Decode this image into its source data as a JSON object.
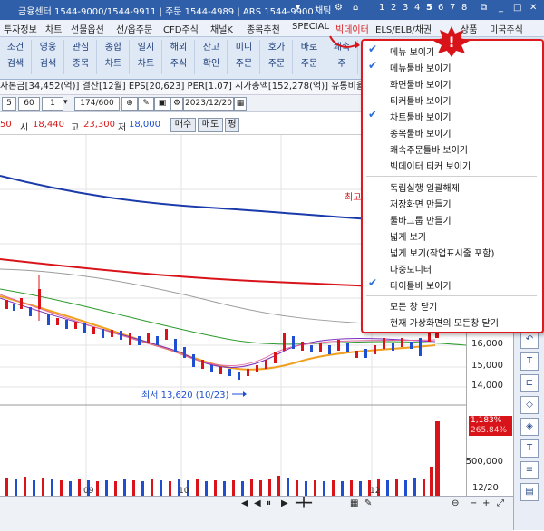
{
  "titlebar": {
    "center": "금융센터 1544-9000/1544-9911 | 주문 1544-4989 | ARS 1544-9900",
    "chat": "채팅",
    "pages": [
      "1",
      "2",
      "3",
      "4",
      "5",
      "6",
      "7",
      "8"
    ]
  },
  "menubar": {
    "items": [
      "투자정보",
      "차트",
      "선물옵션",
      "선/옵주문",
      "CFD주식",
      "채널K",
      "종목추천",
      "SPECIAL",
      "빅데이터",
      "ELS/ELB/채권",
      "상품",
      "미국주식"
    ]
  },
  "toolbar": {
    "buttons": [
      {
        "l1": "조건",
        "l2": "검색"
      },
      {
        "l1": "영웅",
        "l2": "검색"
      },
      {
        "l1": "관심",
        "l2": "종목"
      },
      {
        "l1": "종합",
        "l2": "차트"
      },
      {
        "l1": "일지",
        "l2": "차트"
      },
      {
        "l1": "해외",
        "l2": "주식"
      },
      {
        "l1": "잔고",
        "l2": "확인"
      },
      {
        "l1": "미니",
        "l2": "주문"
      },
      {
        "l1": "호가",
        "l2": "주문"
      },
      {
        "l1": "바로",
        "l2": "주문"
      },
      {
        "l1": "쾌속",
        "l2": "주"
      }
    ]
  },
  "infoline": "자본금[34,452(억)] 결산[12월] EPS[20,623] PER[1.07] 시가총액[152,278(억)] 유통비율",
  "controls": {
    "period": "5",
    "interval": "60",
    "step": "1",
    "count": "174/600",
    "date": "2023/12/20"
  },
  "pricerow": {
    "prefix": "50",
    "open_label": "시",
    "open": "18,440",
    "high_label": "고",
    "high": "23,300",
    "low_label": "저",
    "low": "18,000",
    "buy": "매수",
    "sell": "매도",
    "eval": "평"
  },
  "chart": {
    "ticks": [
      "16,000",
      "15,000",
      "14,000",
      "500,000"
    ],
    "low_label": "최저 13,620 (10/23)",
    "high_label_partial": "최고",
    "rate1": "1,183%",
    "rate2": "265.84%",
    "months": [
      "09",
      "10",
      "12"
    ],
    "date_label": "12/20"
  },
  "menu": {
    "items": [
      {
        "label": "메뉴 보이기",
        "checked": true
      },
      {
        "label": "메뉴툴바 보이기",
        "checked": true
      },
      {
        "label": "화면툴바 보이기",
        "checked": false
      },
      {
        "label": "티커툴바 보이기",
        "checked": false
      },
      {
        "label": "차트툴바 보이기",
        "checked": true
      },
      {
        "label": "종목툴바 보이기",
        "checked": false
      },
      {
        "label": "쾌속주문툴바 보이기",
        "checked": false
      },
      {
        "label": "빅데이터 티커 보이기",
        "checked": false
      },
      {
        "label": "독립실행 일괄해제",
        "checked": false
      },
      {
        "label": "저장화면 만들기",
        "checked": false
      },
      {
        "label": "툴바그룹 만들기",
        "checked": false
      },
      {
        "label": "넓게 보기",
        "checked": false
      },
      {
        "label": "넓게 보기(작업표시줄 포함)",
        "checked": false
      },
      {
        "label": "다중모니터",
        "checked": false
      },
      {
        "label": "타이틀바 보이기",
        "checked": true
      },
      {
        "label": "모든 창 닫기",
        "checked": false
      },
      {
        "label": "현재 가상화면의 모든창 닫기",
        "checked": false
      }
    ]
  },
  "colors": {
    "accent": "#2f5fa8",
    "menu_border": "#e0191f",
    "up": "#e0191f",
    "down": "#1f4fd0"
  }
}
